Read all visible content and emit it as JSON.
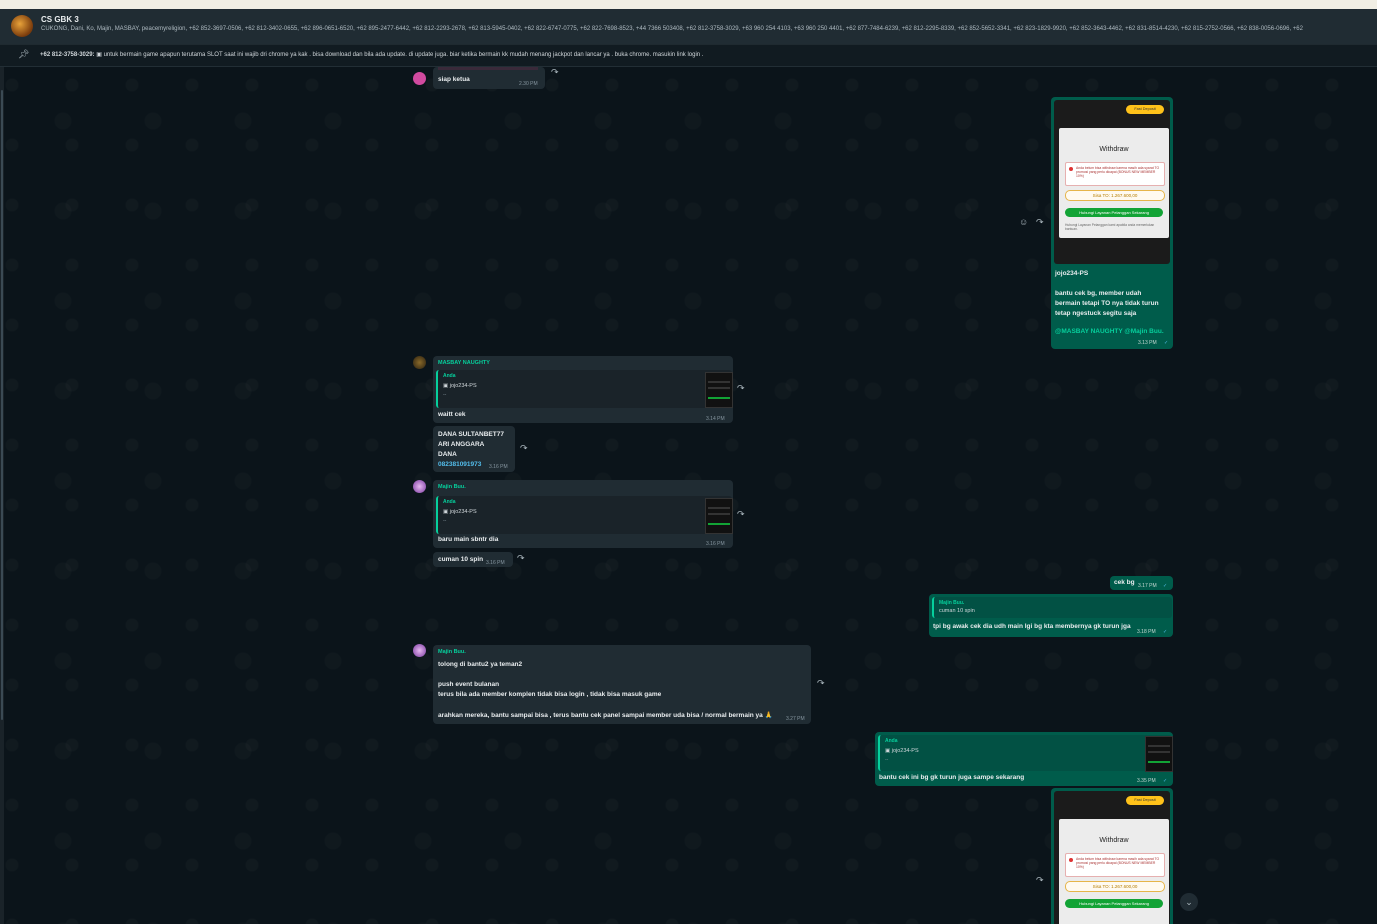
{
  "header": {
    "title": "CS GBK 3",
    "members": "CUKONG, Dani, Ko, Majin, MASBAY, peacemyreligion, +62 852-3697-0506, +62 812-3402-0655, +62 896-0651-6520, +62 895-2477-6442, +62 812-2293-2678, +62 813-5945-0402, +62 822-6747-0775, +62 822-7698-8523, +44 7366 503408, +62 812-3758-3029, +63 960 254 4103, +63 960 250 4401, +62 877-7484-6239, +62 812-2295-8339, +62 852-5652-3341, +62 823-1829-9920, +62 852-3643-4462, +62 831-8514-4230, +62 815-2752-0566, +62 838-0056-0696, +62"
  },
  "pinned": {
    "sender": "+62 812-3758-3029:",
    "text": "untuk bermain game apapun terutama SLOT saat ini wajib dri chrome ya kak . bisa download dan bila ada update. di update juga. biar ketika bermain  kk mudah menang jackpot dan lancar ya . buka chrome. masukin link login ."
  },
  "messages": {
    "m1": {
      "text": "siap ketua",
      "time": "2.30 PM"
    },
    "m2": {
      "withdraw_title": "Withdraw",
      "fast_badge": "Fast Deposit",
      "alert": "Anda belum bisa withdraw karena masih ada syarat TO promosi yang perlu dicapai (BONUS NEW MEMBER 10%)",
      "sisa": "Sisa TO: 1.267.600,00",
      "button": "Hubungi Layanan Pelanggan Sekarang",
      "footer": "Hubungi Layanan Pelanggan kami apabila anda memerlukan bantuan.",
      "line1": "jojo234-PS",
      "line2": "bantu cek bg, member udah",
      "line3": "bermain tetapi TO nya tidak turun",
      "line4": "tetap ngestuck segitu saja",
      "mentions": "@MASBAY NAUGHTY @Majin Buu.",
      "time": "3.13 PM",
      "react_icon": "smiley-icon"
    },
    "m3": {
      "sender": "MASBAY NAUGHTY",
      "quote_name": "Anda",
      "quote_text": "jojo234-PS",
      "quote_dash": "--",
      "text": "waitt cek",
      "time": "3.14 PM"
    },
    "m4": {
      "l1": "DANA SULTANBET77",
      "l2": "ARI ANGGARA",
      "l3": "DANA",
      "l4": "082381091973",
      "time": "3.16 PM"
    },
    "m5": {
      "sender": "Majin Buu.",
      "quote_name": "Anda",
      "quote_text": "jojo234-PS",
      "quote_dash": "--",
      "text": "baru main sbntr dia",
      "time": "3.16 PM"
    },
    "m6": {
      "text": "cuman 10 spin",
      "time": "3.16 PM"
    },
    "m7": {
      "text": "cek bg",
      "time": "3.17 PM"
    },
    "m8": {
      "quote_name": "Majin Buu.",
      "quote_text": "cuman 10 spin",
      "text": "tpi bg awak cek dia udh main lgi bg kta membernya gk turun jga",
      "time": "3.18 PM"
    },
    "m9": {
      "sender": "Majin Buu.",
      "l1": "tolong di bantu2 ya teman2",
      "l2": "push event bulanan",
      "l3": "terus bila ada member komplen tidak bisa login , tidak bisa masuk game",
      "l4": "arahkan mereka, bantu sampai bisa , terus bantu cek panel sampai member uda bisa / normal bermain ya 🙏",
      "time": "3.27 PM"
    },
    "m10": {
      "quote_name": "Anda",
      "quote_text": "jojo234-PS",
      "quote_dash": "--",
      "text": "bantu cek ini bg gk turun juga sampe sekarang",
      "time": "3.35 PM"
    },
    "m11": {
      "withdraw_title": "Withdraw",
      "fast_badge": "Fast Deposit",
      "alert": "Anda belum bisa withdraw karena masih ada syarat TO promosi yang perlu dicapai (BONUS NEW MEMBER 10%)",
      "sisa": "Sisa TO: 1.267.600,00",
      "button": "Hubungi Layanan Pelanggan Sekarang"
    }
  },
  "icons": {
    "pin": "pin-icon",
    "forward": "forward-icon",
    "scroll": "chevron-down-icon"
  },
  "colors": {
    "bg": "#0b141a",
    "incoming": "#202c33",
    "outgoing": "#005c4b",
    "accent": "#06cf9c"
  }
}
